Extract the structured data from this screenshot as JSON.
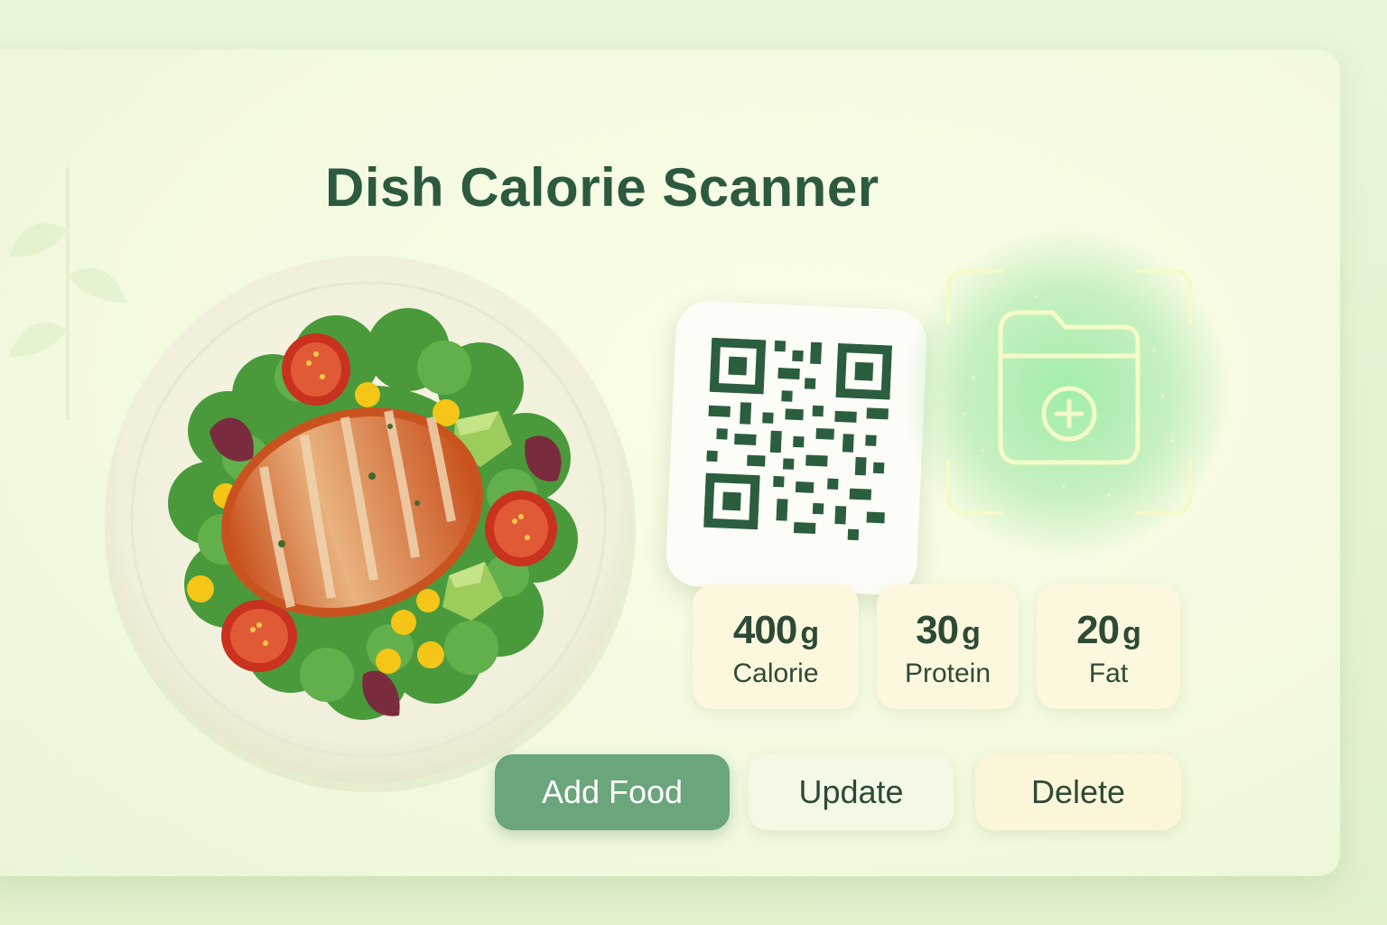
{
  "app": {
    "title": "Dish Calorie Scanner"
  },
  "scanner": {
    "qr_icon": "qr-code-icon",
    "add_file_icon": "folder-add-icon"
  },
  "stats": [
    {
      "value": "400",
      "unit": "g",
      "label": "Calorie"
    },
    {
      "value": "30",
      "unit": "g",
      "label": "Protein"
    },
    {
      "value": "20",
      "unit": "g",
      "label": "Fat"
    }
  ],
  "actions": {
    "add_label": "Add Food",
    "update_label": "Update",
    "delete_label": "Delete"
  },
  "colors": {
    "title": "#2d5a3f",
    "primary_button": "#6ba57c",
    "glow": "#84e896",
    "background": "#eaf6d9"
  }
}
